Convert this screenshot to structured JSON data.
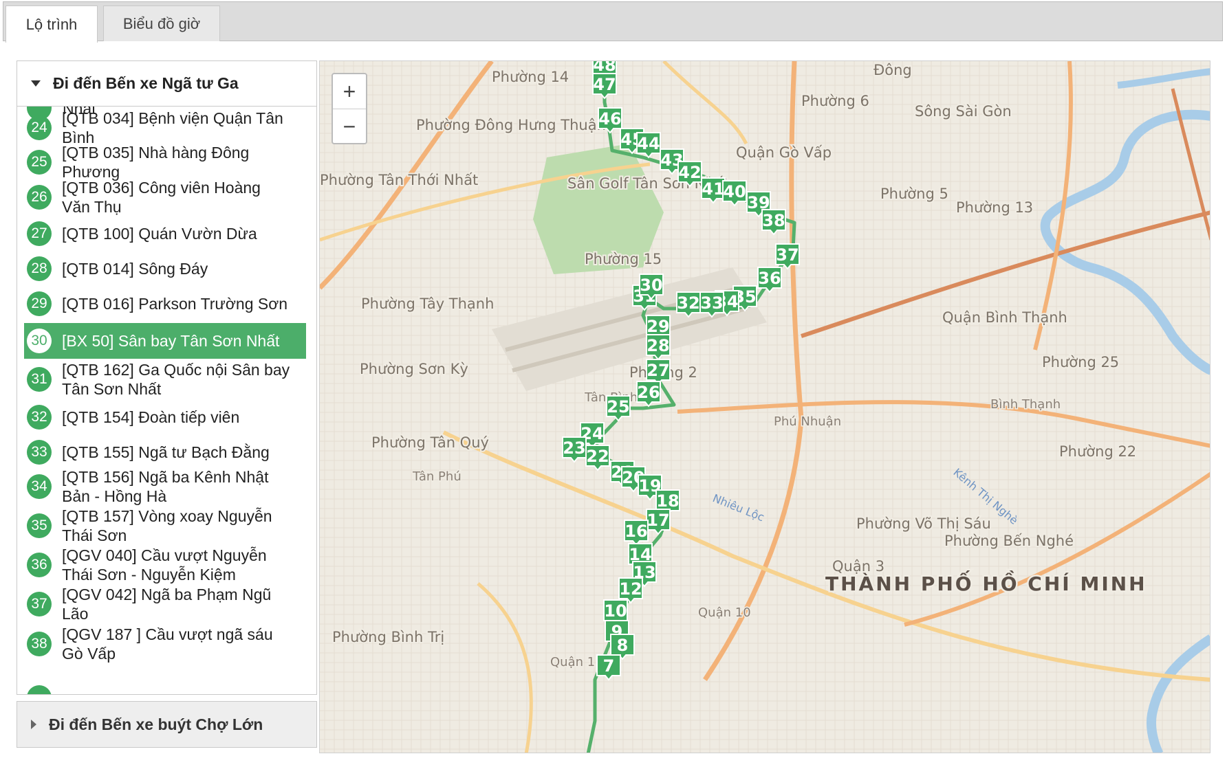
{
  "tabs": [
    {
      "label": "Lộ trình"
    },
    {
      "label": "Biểu đồ giờ"
    }
  ],
  "sidebar": {
    "section_open": "Đi đến Bến xe Ngã tư Ga",
    "section_closed": "Đi đến Bến xe buýt Chợ Lớn",
    "partial_top_text": "Nhất",
    "stops": [
      {
        "num": "24",
        "line1": "[QTB 034] Bệnh viện Quận Tân",
        "line2": "Bình"
      },
      {
        "num": "25",
        "line1": "[QTB 035] Nhà hàng Đông",
        "line2": "Phương"
      },
      {
        "num": "26",
        "line1": "[QTB 036] Công viên Hoàng",
        "line2": "Văn Thụ"
      },
      {
        "num": "27",
        "line1": "[QTB 100] Quán Vườn Dừa",
        "line2": ""
      },
      {
        "num": "28",
        "line1": "[QTB 014] Sông Đáy",
        "line2": ""
      },
      {
        "num": "29",
        "line1": "[QTB 016] Parkson Trường Sơn",
        "line2": ""
      },
      {
        "num": "30",
        "line1": "[BX 50] Sân bay Tân Sơn Nhất",
        "line2": "",
        "selected": true
      },
      {
        "num": "31",
        "line1": "[QTB 162] Ga Quốc nội Sân bay",
        "line2": "Tân Sơn Nhất"
      },
      {
        "num": "32",
        "line1": "[QTB 154] Đoàn tiếp viên",
        "line2": ""
      },
      {
        "num": "33",
        "line1": "[QTB 155] Ngã tư Bạch Đằng",
        "line2": ""
      },
      {
        "num": "34",
        "line1": "[QTB 156] Ngã ba Kênh Nhật",
        "line2": "Bản - Hồng Hà"
      },
      {
        "num": "35",
        "line1": "[QTB 157] Vòng xoay Nguyễn",
        "line2": "Thái Sơn"
      },
      {
        "num": "36",
        "line1": "[QGV 040] Cầu vượt Nguyễn",
        "line2": "Thái Sơn - Nguyễn Kiệm"
      },
      {
        "num": "37",
        "line1": "[QGV 042] Ngã ba Phạm Ngũ",
        "line2": "Lão"
      },
      {
        "num": "38",
        "line1": "[QGV 187 ] Cầu vượt ngã sáu",
        "line2": "Gò Vấp"
      }
    ]
  },
  "map": {
    "zoom_in": "+",
    "zoom_out": "−",
    "city_label": "THÀNH PHỐ HỒ CHÍ MINH",
    "area_labels": [
      "Phường 14",
      "Phường Đông Hưng Thuận",
      "Đông",
      "Phường 6",
      "Sông Sài Gòn",
      "Quận Gò Vấp",
      "Sân Golf Tân Sơn Nhất",
      "Phường Tân Thới Nhất",
      "Phường 5",
      "Phường 13",
      "Phường 15",
      "Phường Tây Thạnh",
      "Quận Bình Thạnh",
      "Phường Sơn Kỳ",
      "Phường 25",
      "Tân Bình",
      "Phú Nhuận",
      "Bình Thạnh",
      "Phường Tân Quý",
      "Tân Phú",
      "Phường 22",
      "Phường Võ Thị Sáu",
      "Phường Bến Nghé",
      "Quận 3",
      "Quận 10",
      "Phường Bình Trị",
      "Quận 11",
      "Nhiêu Lộc",
      "Kênh Thị Nghè",
      "Phường 2"
    ],
    "markers": [
      "48",
      "47",
      "46",
      "45",
      "44",
      "43",
      "42",
      "41",
      "40",
      "39",
      "38",
      "37",
      "36",
      "35",
      "34",
      "33",
      "32",
      "31",
      "30",
      "29",
      "28",
      "27",
      "26",
      "25",
      "24",
      "23",
      "22",
      "21",
      "20",
      "19",
      "18",
      "17",
      "16",
      "14",
      "13",
      "12",
      "10",
      "9",
      "8",
      "7"
    ]
  },
  "colors": {
    "accent": "#4cae6a",
    "marker": "#3faa5f",
    "route": "#55b06b",
    "map_bg": "#f1ede4",
    "main_road": "#f3b278",
    "airport": "#bddcae"
  }
}
